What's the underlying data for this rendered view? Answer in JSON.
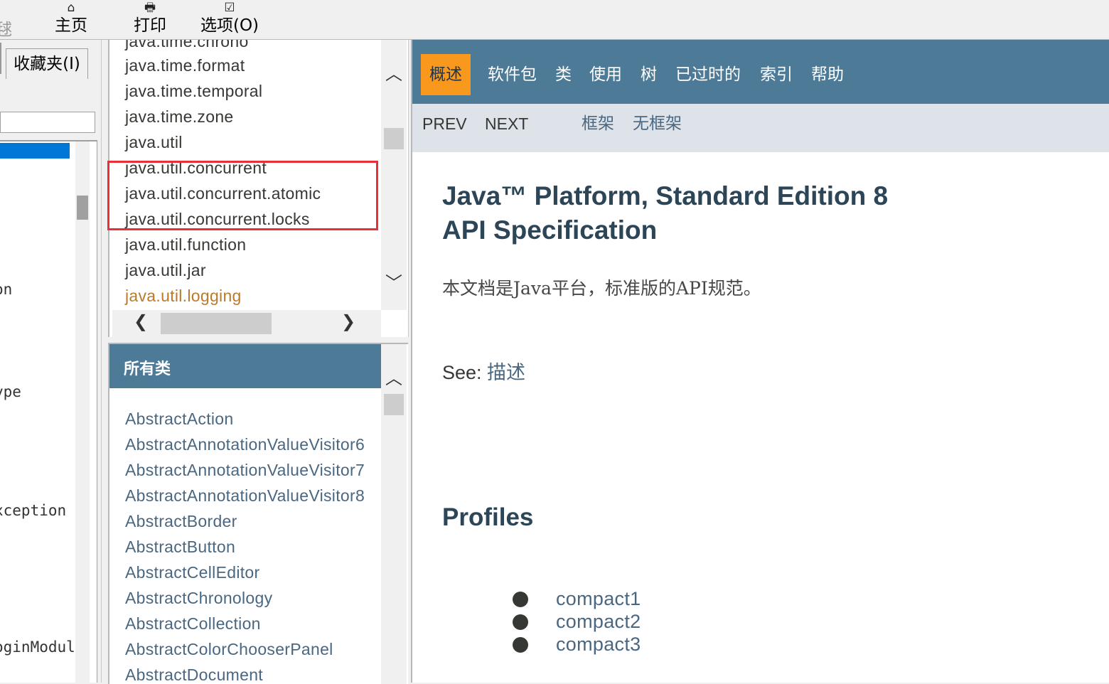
{
  "toolbar": {
    "cut_label": "毬",
    "home_label": "主页",
    "print_label": "打印",
    "options_label": "选项(O)"
  },
  "left_pane": {
    "favorites_tab": "收藏夹(I)",
    "items": [
      "on",
      "ype",
      "xception",
      "oginModul"
    ]
  },
  "packages": {
    "items": [
      "java.time.chrono",
      "java.time.format",
      "java.time.temporal",
      "java.time.zone",
      "java.util",
      "java.util.concurrent",
      "java.util.concurrent.atomic",
      "java.util.concurrent.locks",
      "java.util.function",
      "java.util.jar",
      "java.util.logging"
    ]
  },
  "classes": {
    "header": "所有类",
    "items": [
      "AbstractAction",
      "AbstractAnnotationValueVisitor6",
      "AbstractAnnotationValueVisitor7",
      "AbstractAnnotationValueVisitor8",
      "AbstractBorder",
      "AbstractButton",
      "AbstractCellEditor",
      "AbstractChronology",
      "AbstractCollection",
      "AbstractColorChooserPanel",
      "AbstractDocument"
    ]
  },
  "content": {
    "nav": [
      "概述",
      "软件包",
      "类",
      "使用",
      "树",
      "已过时的",
      "索引",
      "帮助"
    ],
    "subnav": {
      "prev": "Prev",
      "next": "Next",
      "frames": "框架",
      "no_frames": "无框架"
    },
    "title_line1": "Java™ Platform, Standard Edition 8",
    "title_line2": "API Specification",
    "description": "本文档是Java平台，标准版的API规范。",
    "see_label": "See: ",
    "see_link": "描述",
    "profiles_heading": "Profiles",
    "profiles": [
      "compact1",
      "compact2",
      "compact3"
    ]
  },
  "colors": {
    "nav_bg": "#4d7a97",
    "nav_active": "#f8981d",
    "subnav_bg": "#dee3e9",
    "link": "#4a6782",
    "visited_link": "#bb7a2a",
    "highlight_border": "#e8303a"
  }
}
